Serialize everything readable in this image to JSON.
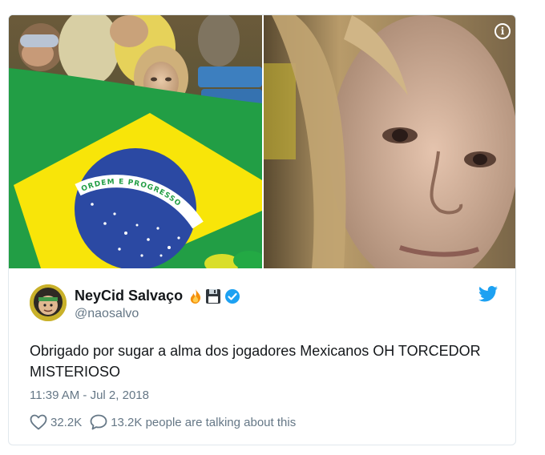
{
  "author": {
    "display_name": "NeyCid Salvaço",
    "handle": "@naosalvo",
    "avatar_icon": "avatar-cartoon-icon",
    "badges": [
      "fire-emoji-icon",
      "floppy-disk-emoji-icon",
      "verified-badge-icon"
    ]
  },
  "media": {
    "flag_banner_text": "ORDEM E PROGRESSO",
    "info_icon": "info-icon"
  },
  "tweet": {
    "text": "Obrigado por sugar a alma dos jogadores Mexicanos OH TORCEDOR MISTERIOSO",
    "timestamp": "11:39 AM - Jul 2, 2018"
  },
  "actions": {
    "like_count": "32.2K",
    "talking_label": "13.2K people are talking about this"
  },
  "colors": {
    "twitter_blue": "#1da1f2",
    "text_primary": "#14171a",
    "text_secondary": "#657786",
    "border": "#e1e8ed",
    "flag_green": "#229e45",
    "flag_yellow": "#f8e509",
    "flag_blue": "#2b49a3"
  }
}
